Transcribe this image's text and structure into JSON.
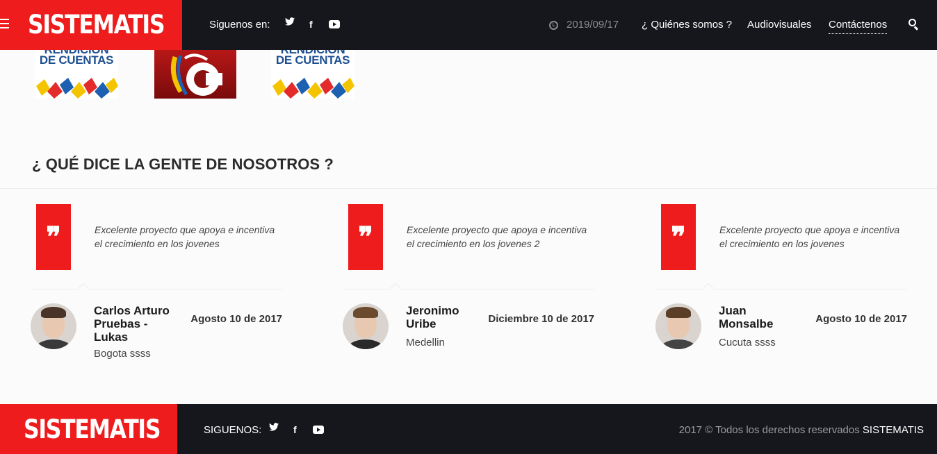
{
  "header": {
    "logo": "SISTEMATIS",
    "follow_label": "Siguenos en:",
    "social_icons": [
      "twitter-icon",
      "facebook-icon",
      "youtube-icon"
    ],
    "date": "2019/09/17",
    "nav": [
      "¿ Quiénes somos ?",
      "Audiovisuales",
      "Contáctenos"
    ],
    "active_nav": "Contáctenos"
  },
  "partners": [
    {
      "icon": "rendicion-cuentas-logo",
      "text_top": "RENDICIÓN",
      "text_bottom": "DE CUENTAS"
    },
    {
      "icon": "c-channel-logo"
    },
    {
      "icon": "rendicion-cuentas-logo",
      "text_top": "RENDICIÓN",
      "text_bottom": "DE CUENTAS"
    }
  ],
  "testimonials_section": {
    "title": "¿ QUÉ DICE LA GENTE DE NOSOTROS ?",
    "items": [
      {
        "quote": "Excelente proyecto que apoya e incentiva el crecimiento en los jovenes",
        "name": "Carlos Arturo Pruebas - Lukas",
        "city": "Bogota ssss",
        "date": "Agosto 10 de 2017"
      },
      {
        "quote": "Excelente proyecto que apoya e incentiva el crecimiento en los jovenes 2",
        "name": "Jeronimo Uribe",
        "city": "Medellin",
        "date": "Diciembre 10 de 2017"
      },
      {
        "quote": "Excelente proyecto que apoya e incentiva el crecimiento en los jovenes",
        "name": "Juan Monsalbe",
        "city": "Cucuta ssss",
        "date": "Agosto 10 de 2017"
      }
    ]
  },
  "footer": {
    "logo": "SISTEMATIS",
    "follow_label": "SIGUENOS:",
    "copyright_prefix": "2017 © Todos los derechos reservados",
    "copyright_brand": "SISTEMATIS"
  },
  "colors": {
    "accent": "#ee1c1c",
    "dark": "#16161d",
    "muted": "#8a8a8f"
  }
}
